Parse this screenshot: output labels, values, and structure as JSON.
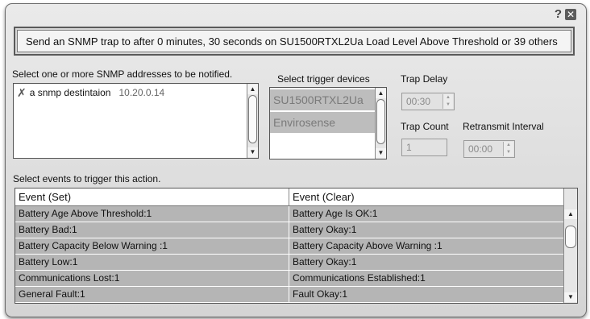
{
  "dialog": {
    "help_label": "?",
    "close_label": "✕",
    "summary": "Send an SNMP trap to  after 0 minutes, 30 seconds on SU1500RTXL2Ua Load Level Above Threshold or 39 others"
  },
  "snmp": {
    "label": "Select one or more SNMP addresses to be notified.",
    "destinations": [
      {
        "name": "a snmp destintaion",
        "address": "10.20.0.14",
        "checked_icon": "x-icon"
      }
    ]
  },
  "devices": {
    "label": "Select trigger devices",
    "items": [
      "SU1500RTXL2Ua",
      "Envirosense"
    ]
  },
  "trap": {
    "delay_label": "Trap Delay",
    "delay_value": "00:30",
    "count_label": "Trap Count",
    "count_value": "1",
    "retransmit_label": "Retransmit Interval",
    "retransmit_value": "00:00"
  },
  "events": {
    "label": "Select events to trigger this action.",
    "headers": [
      "Event (Set)",
      "Event (Clear)"
    ],
    "rows": [
      [
        "Battery Age Above Threshold:1",
        "Battery Age Is OK:1"
      ],
      [
        "Battery Bad:1",
        "Battery Okay:1"
      ],
      [
        "Battery Capacity Below Warning :1",
        "Battery Capacity Above Warning :1"
      ],
      [
        "Battery Low:1",
        "Battery Okay:1"
      ],
      [
        "Communications Lost:1",
        "Communications Established:1"
      ],
      [
        "General Fault:1",
        "Fault Okay:1"
      ]
    ]
  },
  "colors": {
    "selected_row": "#b5b5b5",
    "dialog_bg": "#dcdcdc"
  }
}
